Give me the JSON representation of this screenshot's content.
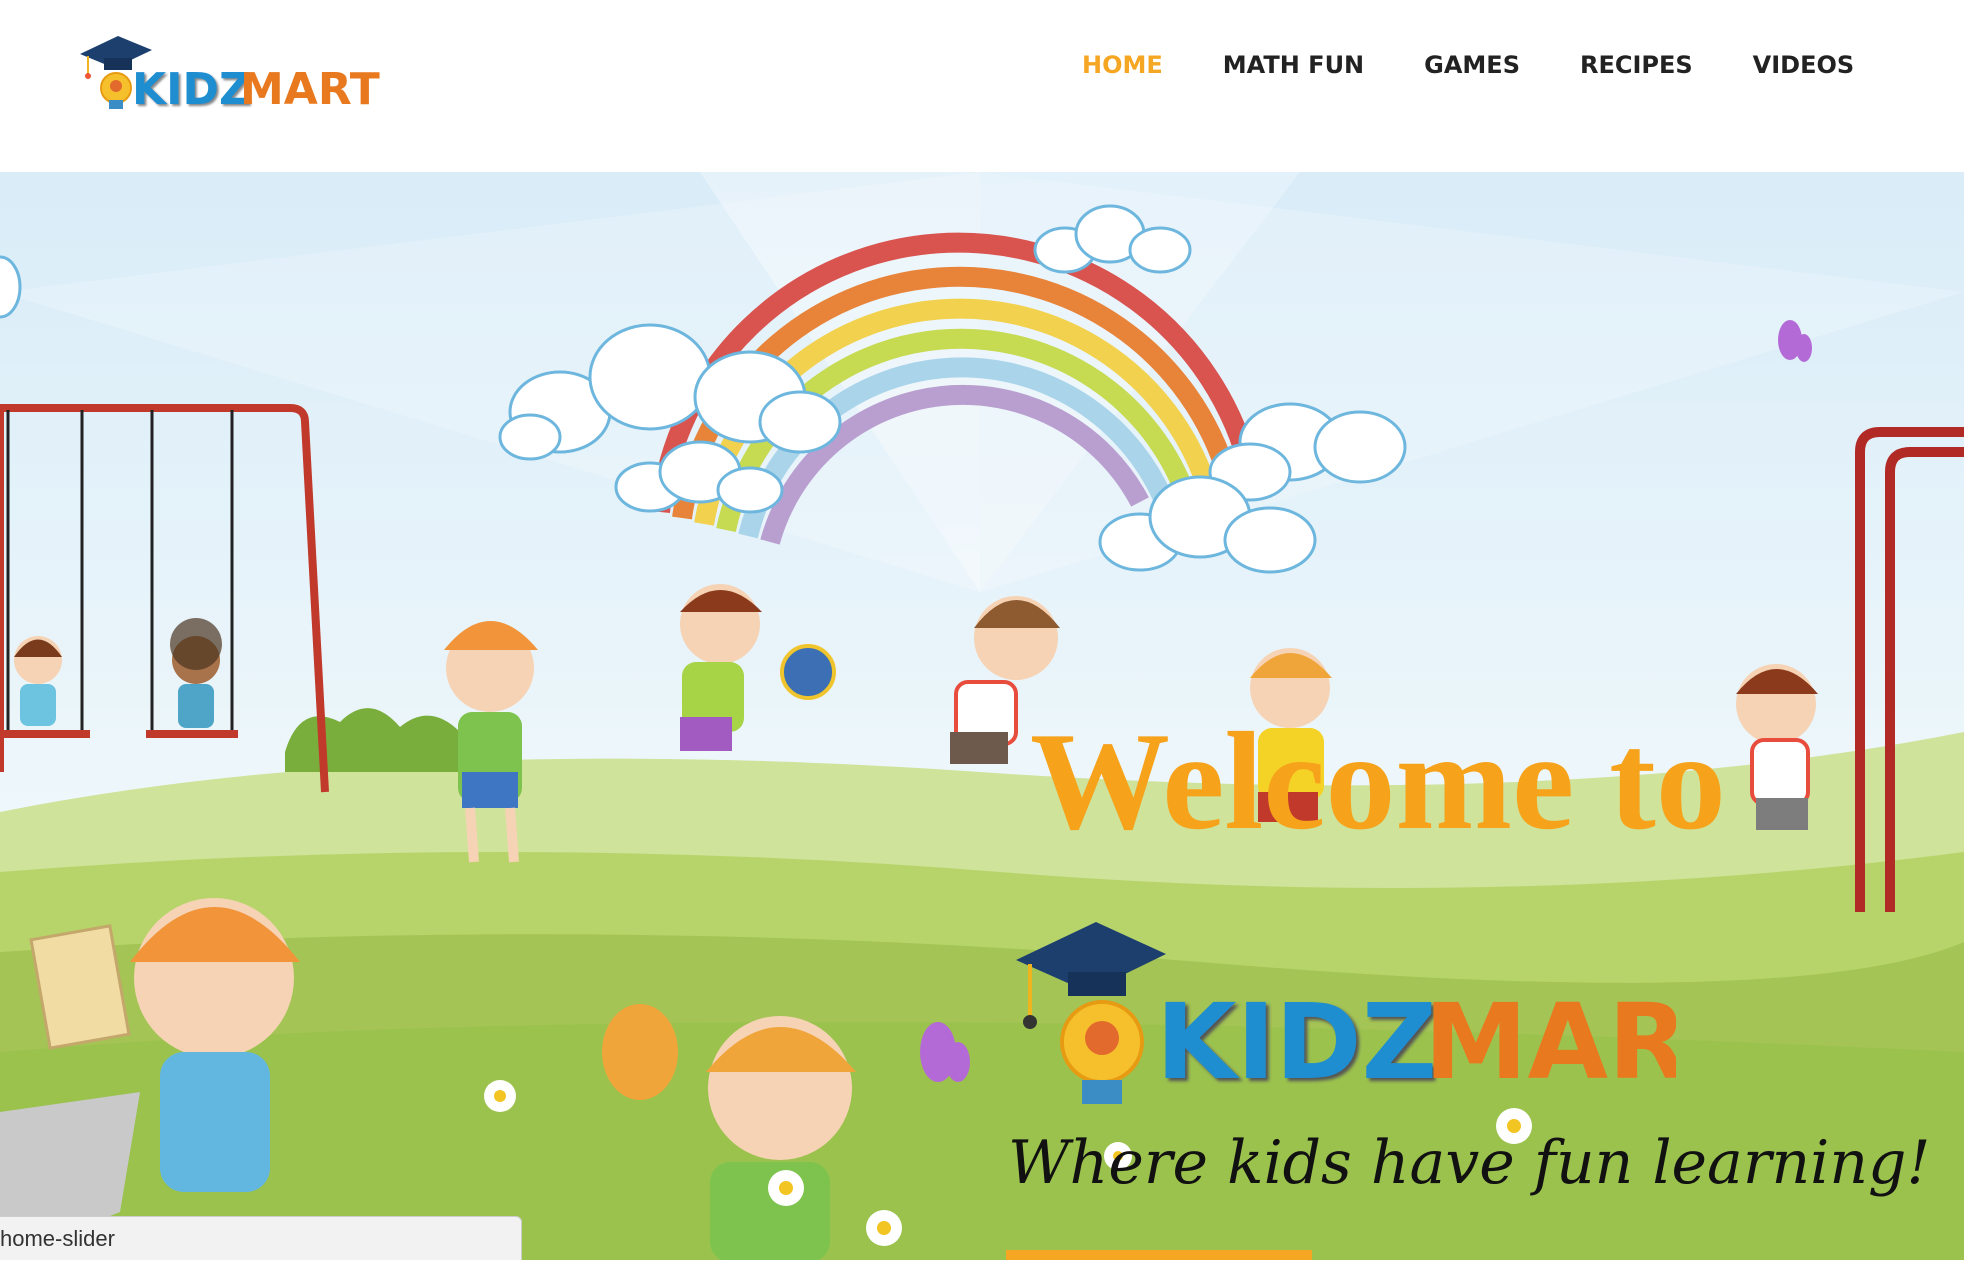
{
  "brand": {
    "name_part1": "KIDZ",
    "name_part2": "MART",
    "colors": {
      "accent": "#f5a623",
      "blue": "#1f8ed1",
      "orange": "#e8791f"
    }
  },
  "nav": {
    "items": [
      {
        "label": "HOME",
        "active": true
      },
      {
        "label": "MATH FUN",
        "active": false
      },
      {
        "label": "GAMES",
        "active": false
      },
      {
        "label": "RECIPES",
        "active": false
      },
      {
        "label": "VIDEOS",
        "active": false
      }
    ]
  },
  "hero": {
    "welcome": "Welcome to",
    "tagline": "Where kids have fun learning!"
  },
  "status_bar": {
    "text": "home-slider"
  }
}
